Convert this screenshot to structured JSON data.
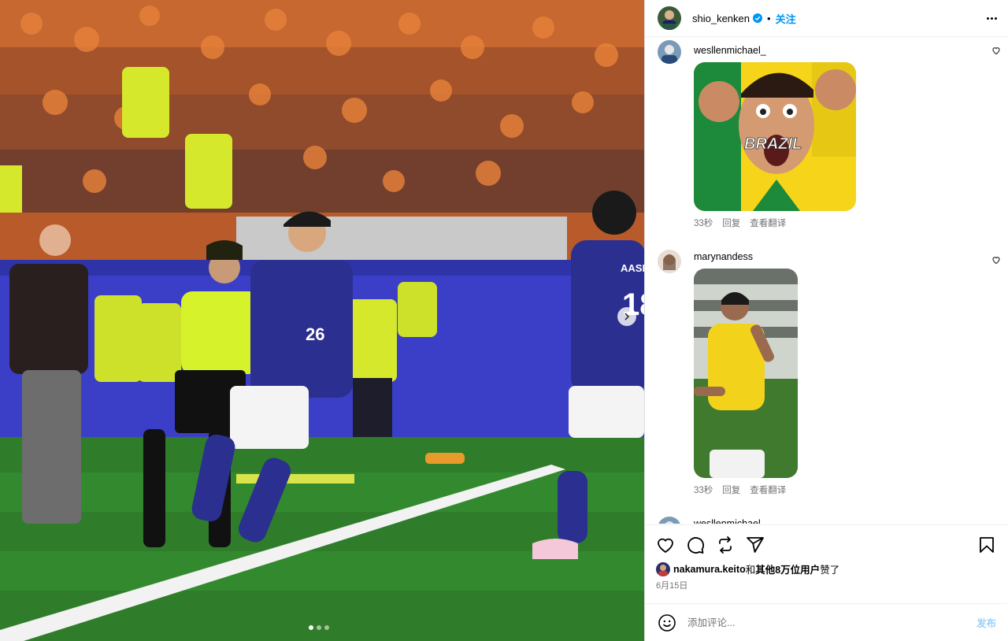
{
  "post": {
    "author": "shio_kenken",
    "follow_label": "关注",
    "separator": "•",
    "carousel": {
      "count": 3,
      "active": 0
    }
  },
  "comments": [
    {
      "username": "wesllenmichael_",
      "gif_text": "BRAZIL",
      "time": "33秒",
      "reply_label": "回复",
      "translate_label": "查看翻译"
    },
    {
      "username": "marynandess",
      "time": "33秒",
      "reply_label": "回复",
      "translate_label": "查看翻译"
    },
    {
      "username": "wesllenmichael_"
    }
  ],
  "likes": {
    "first_user": "nakamura.keito",
    "connector": "和",
    "others": "其他8万位用户",
    "suffix": "赞了"
  },
  "date": "6月15日",
  "add_comment": {
    "placeholder": "添加评论...",
    "post_label": "发布"
  },
  "colors": {
    "accent": "#0095f6",
    "japan_kit": "#2b2f8f",
    "referee": "#d6f22a",
    "pitch": "#2f7d2b"
  },
  "icons": [
    "verified-badge-icon",
    "more-icon",
    "heart-icon",
    "comment-icon",
    "repost-icon",
    "share-icon",
    "save-icon",
    "emoji-icon",
    "chevron-right-icon"
  ]
}
